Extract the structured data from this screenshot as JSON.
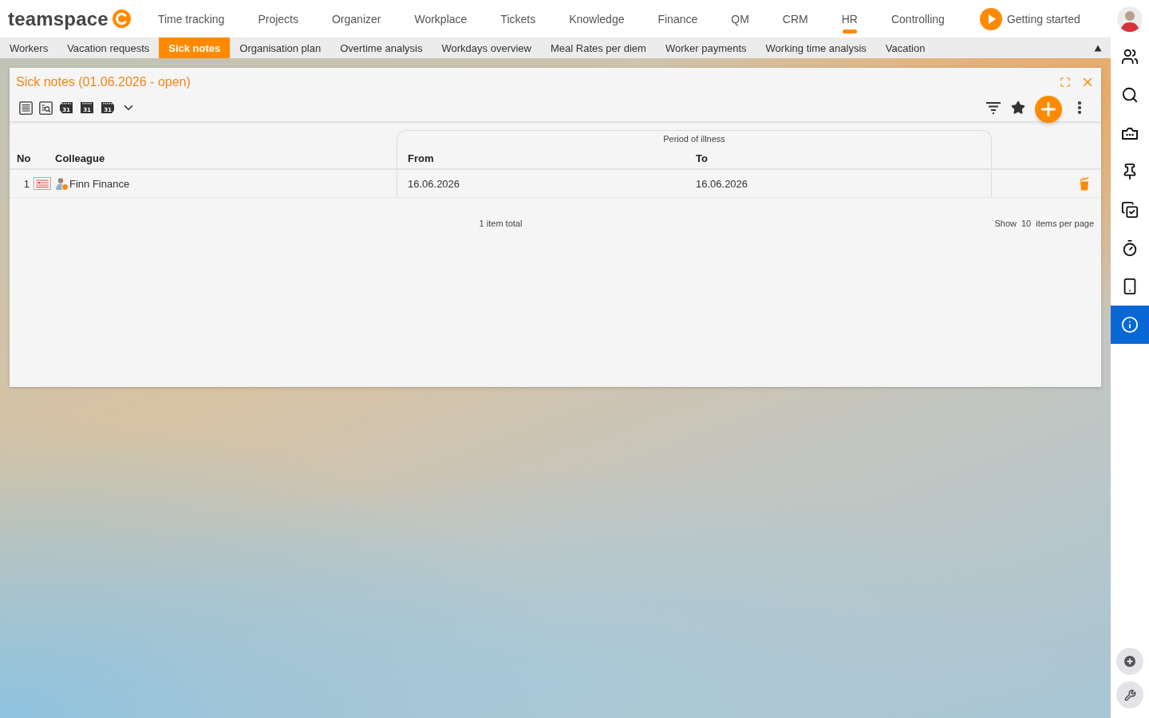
{
  "logo": {
    "text": "teamspace"
  },
  "top_nav": {
    "items": [
      {
        "label": "Time tracking",
        "selected": false
      },
      {
        "label": "Projects",
        "selected": false
      },
      {
        "label": "Organizer",
        "selected": false
      },
      {
        "label": "Workplace",
        "selected": false
      },
      {
        "label": "Tickets",
        "selected": false
      },
      {
        "label": "Knowledge",
        "selected": false
      },
      {
        "label": "Finance",
        "selected": false
      },
      {
        "label": "QM",
        "selected": false
      },
      {
        "label": "CRM",
        "selected": false
      },
      {
        "label": "HR",
        "selected": true
      },
      {
        "label": "Controlling",
        "selected": false
      }
    ],
    "getting_started": "Getting started"
  },
  "sub_tabs": [
    {
      "label": "Workers",
      "selected": false
    },
    {
      "label": "Vacation requests",
      "selected": false
    },
    {
      "label": "Sick notes",
      "selected": true
    },
    {
      "label": "Organisation plan",
      "selected": false
    },
    {
      "label": "Overtime analysis",
      "selected": false
    },
    {
      "label": "Workdays overview",
      "selected": false
    },
    {
      "label": "Meal Rates per diem",
      "selected": false
    },
    {
      "label": "Worker payments",
      "selected": false
    },
    {
      "label": "Working time analysis",
      "selected": false
    },
    {
      "label": "Vacation",
      "selected": false
    }
  ],
  "panel": {
    "title": "Sick notes (01.06.2026 - open)",
    "view_tools": [
      {
        "kind": "list"
      },
      {
        "kind": "search_list"
      },
      {
        "kind": "calendar_prev",
        "label": "31"
      },
      {
        "kind": "calendar",
        "label": "31"
      },
      {
        "kind": "calendar_next",
        "label": "31"
      }
    ],
    "table": {
      "group_header": "Period of illness",
      "columns": [
        "No",
        "Colleague",
        "From",
        "To"
      ],
      "rows": [
        {
          "no": "1",
          "colleague": "Finn Finance",
          "from": "16.06.2026",
          "to": "16.06.2026"
        }
      ]
    },
    "footer": {
      "total": "1 item total",
      "show_label": "Show",
      "page_size": "10",
      "per_page_label": "items per page"
    }
  },
  "sidebar": {
    "items": [
      {
        "kind": "people",
        "selected": false
      },
      {
        "kind": "search",
        "selected": false
      },
      {
        "kind": "folder",
        "selected": false
      },
      {
        "kind": "pin",
        "selected": false
      },
      {
        "kind": "tasks",
        "selected": false
      },
      {
        "kind": "timer",
        "selected": false
      },
      {
        "kind": "phone",
        "selected": false
      },
      {
        "kind": "info",
        "selected": true
      }
    ]
  }
}
